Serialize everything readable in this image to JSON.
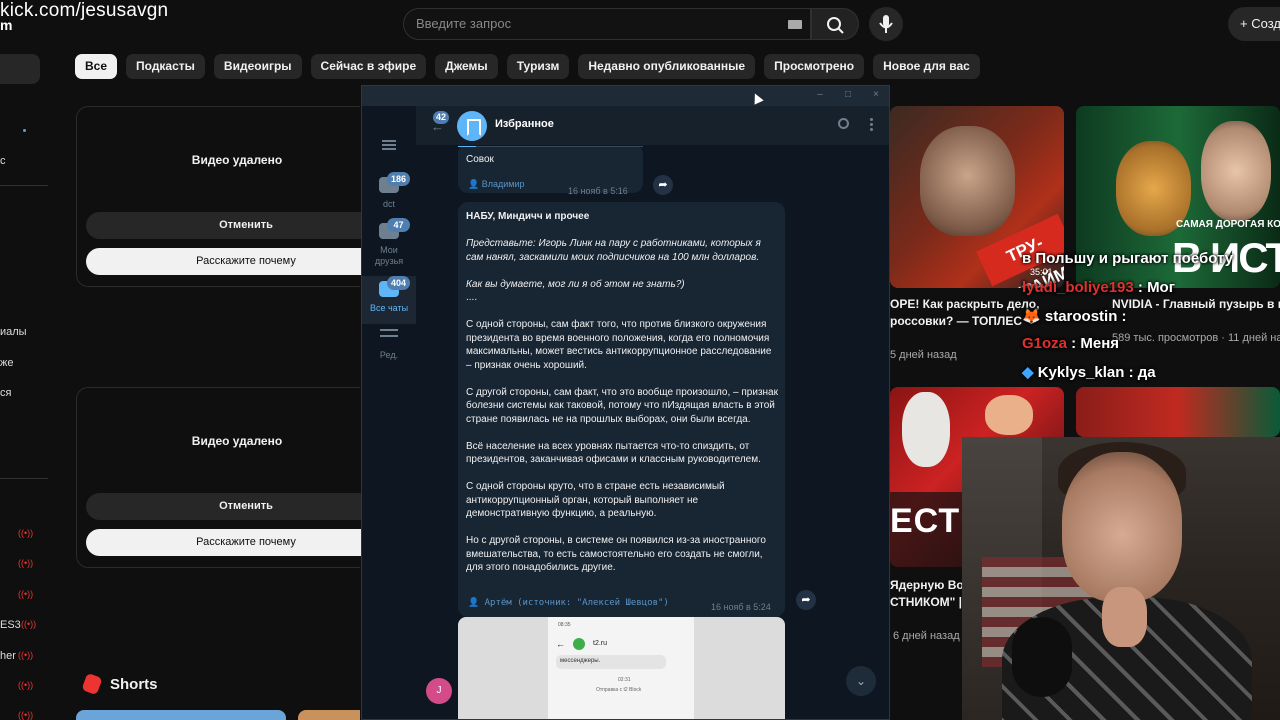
{
  "stream": {
    "url": "kick.com/jesusavgn",
    "url_fragment": "m"
  },
  "youtube": {
    "search_placeholder": "Введите запрос",
    "create_label": "Созд",
    "chips": [
      "Все",
      "Подкасты",
      "Видеоигры",
      "Сейчас в эфире",
      "Джемы",
      "Туризм",
      "Недавно опубликованные",
      "Просмотрено",
      "Новое для вас"
    ],
    "sidebar_fragments": [
      "с",
      "иалы",
      "же",
      "ся",
      "ES3",
      "her"
    ],
    "removed_cards": [
      {
        "title": "Видео удалено",
        "cancel": "Отменить",
        "why": "Расскажите почему"
      },
      {
        "title": "Видео удалено",
        "cancel": "Отменить",
        "why": "Расскажите почему"
      }
    ],
    "shorts_label": "Shorts",
    "videos": [
      {
        "thumb_text": "ТРУ-КРАЙМ",
        "title_line1": "ОРЕ! Как раскрыть дело,",
        "title_line2": "россовки? — ТОПЛЕС",
        "meta": "5 дней назад"
      },
      {
        "thumb_text_top": "САМАЯ ДОРОГАЯ КОМП",
        "thumb_text_big": "В ИСТОРІ",
        "title_line1": "NVIDIA - Главный пузырь в ис",
        "meta": "589 тыс. просмотров · 11 дней наз"
      },
      {
        "thumb_text": "ЕСТН",
        "title_line1": "Ядерную Вой",
        "title_line2": "СТНИКОМ\" | Е",
        "meta": "6 дней назад"
      }
    ]
  },
  "stream_chat": [
    {
      "user": "",
      "text": "в Польшу и рыгают поеботу",
      "color": "#ffffff"
    },
    {
      "user": "lyudi_boliye193",
      "text": "Мог",
      "color": "#e0312f"
    },
    {
      "user": "staroostin",
      "text": "",
      "color": "#ffffff"
    },
    {
      "user": "G1oza",
      "text": "Меня",
      "color": "#e0312f"
    },
    {
      "user": "Kyklys_klan",
      "text": "да",
      "color": "#ffffff"
    }
  ],
  "stream_chat_time": "35:01",
  "telegram": {
    "chat_title": "Избранное",
    "back_badge": "42",
    "folders": [
      {
        "label": "dct",
        "badge": "186"
      },
      {
        "label": "Мои друзья",
        "badge": "47"
      },
      {
        "label": "Все чаты",
        "badge": "404"
      },
      {
        "label": "Ред.",
        "badge": ""
      }
    ],
    "messages": [
      {
        "text": "Совок",
        "sig": "Владимир",
        "time": "16 нояб в 5:16"
      },
      {
        "title": "НАБУ, Миндичч и прочее",
        "italic1": "Представьте: Игорь Линк на пару с работниками, которых я сам нанял, заскамили моих подписчиков на 100 млн долларов.",
        "italic2": "Как вы думаете, мог ли я об этом не знать?)",
        "dots": "....",
        "p1": "С одной стороны, сам факт того, что против близкого окружения президента во время военного положения, когда его полномочия максимальны, может вестись антикоррупционное расследование – признак очень хороший.",
        "p2": "С другой стороны, сам факт, что это вообще произошло, – признак болезни системы как таковой, потому что пИздящая власть в этой стране появилась не на прошлых выборах, они были всегда.",
        "p3": "Всё население на всех уровнях пытается что-то спиздить, от президентов, заканчивая офисами и классным руководителем.",
        "p4": "С одной стороны круто, что в стране есть независимый антикоррупционный орган, который выполняет не демонстративную функцию, а реальную.",
        "p5": "Но с другой стороны, в системе он появился из-за иностранного вмешательства, то есть самостоятельно его создать не смогли, для этого понадобились другие.",
        "sig": "Артём (источник: \"Алексей Шевцов\")",
        "time": "16 нояб в 5:24"
      }
    ],
    "phone": {
      "name": "t2.ru",
      "msg": "мессенджеры.",
      "time": "02:31",
      "sent": "Отправка с t2 Block"
    },
    "user_avatar_letter": "J"
  }
}
